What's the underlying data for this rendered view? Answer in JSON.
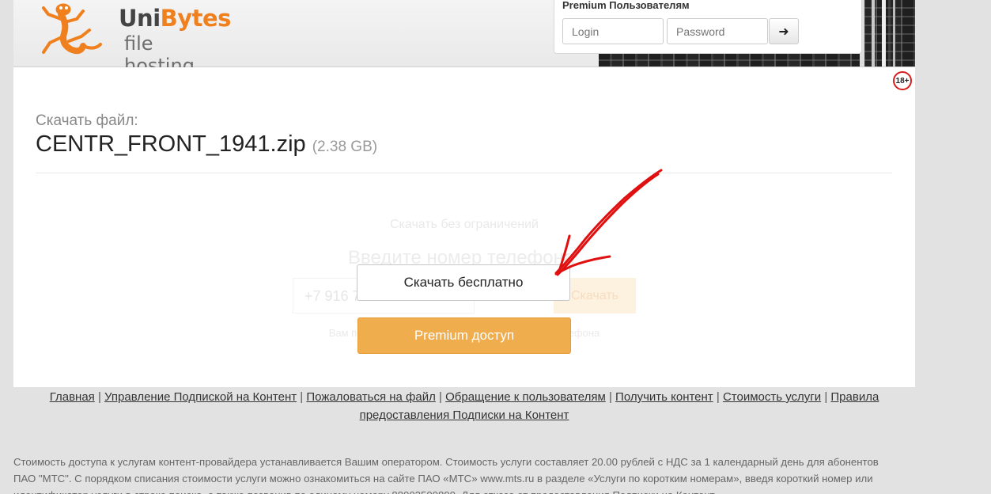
{
  "logo": {
    "brand_uni": "Uni",
    "brand_bytes": "Bytes",
    "tagline": "file hosting"
  },
  "login": {
    "title": "Premium Пользователям",
    "login_placeholder": "Login",
    "password_placeholder": "Password",
    "submit_glyph": "➜"
  },
  "age_badge": "18+",
  "file": {
    "label": "Скачать файл:",
    "name": "CENTR_FRONT_1941.zip",
    "size": "(2.38 GB)"
  },
  "overlay": {
    "unlimited_title": "Скачать без ограничений",
    "phone_prompt": "Введите номер телефона",
    "phone_placeholder": "+7 916 777-77-77",
    "phone_button": "Скачать",
    "sms_note": "Вам придет SMS с кодом на указанный номер телефона"
  },
  "buttons": {
    "free": "Скачать бесплатно",
    "premium": "Premium доступ"
  },
  "footer": {
    "links": [
      "Главная",
      "Управление Подпиской на Контент",
      "Пожаловаться на файл",
      "Обращение к пользователям",
      "Получить контент",
      "Стоимость услуги",
      "Правила предоставления Подписки на Контент"
    ],
    "separator": "|",
    "legal_text": "Стоимость доступа к услугам контент-провайдера устанавливается Вашим оператором. Стоимость услуги составляет 20.00 рублей с НДС за 1 календарный день для абонентов ПАО \"МТС\". С порядком списания стоимости услуги можно ознакомиться на сайте ПАО «МТС» www.mts.ru в разделе «Услуги по коротким номерам», введя короткий номер или идентификатор услуги в строке поиска, а также позвонив по единому номеру 88002500890. Для отказа от предоставления Подписки на Контент"
  },
  "colors": {
    "brand_orange": "#f07f1d",
    "premium_button": "#f0ad4e",
    "annotation_arrow": "#e01010"
  }
}
